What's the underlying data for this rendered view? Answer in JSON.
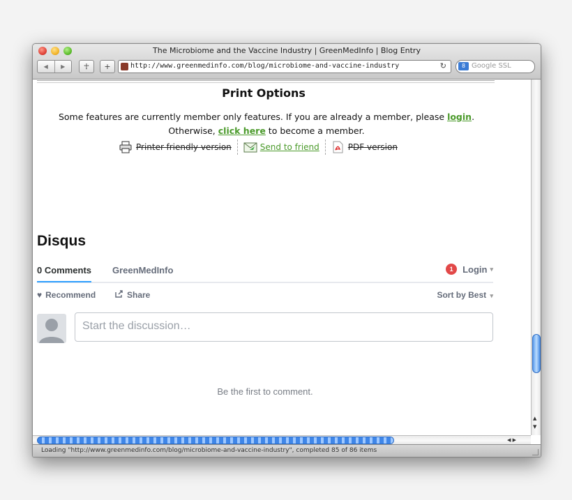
{
  "window": {
    "title": "The Microbiome and the Vaccine Industry | GreenMedInfo | Blog Entry"
  },
  "toolbar": {
    "back_glyph": "◀",
    "forward_glyph": "▶",
    "ankh_glyph": "☥",
    "add_glyph": "+",
    "url": "http://www.greenmedinfo.com/blog/microbiome-and-vaccine-industry",
    "reload_glyph": "↻",
    "search_badge": "8",
    "search_placeholder": "Google SSL"
  },
  "print_options": {
    "title": "Print Options",
    "line1_prefix": "Some features are currently member only features. If you are already a member, please ",
    "login_link": "login",
    "line1_suffix": ".",
    "line2_prefix": "Otherwise, ",
    "click_here_link": "click here",
    "line2_suffix": " to become a member.",
    "printer_friendly": "Printer-friendly version",
    "send_to_friend": "Send to friend",
    "pdf_version": "PDF version"
  },
  "disqus": {
    "title": "Disqus",
    "tab_comments": "0 Comments",
    "tab_site": "GreenMedInfo",
    "notification_count": "1",
    "login_label": "Login",
    "recommend_label": "Recommend",
    "share_label": "Share",
    "sort_label": "Sort by Best",
    "composer_placeholder": "Start the discussion…",
    "first_comment": "Be the first to comment."
  },
  "status_bar": {
    "text": "Loading \"http://www.greenmedinfo.com/blog/microbiome-and-vaccine-industry\", completed 85 of 86 items"
  },
  "colors": {
    "link_green": "#4a9a2a",
    "disqus_blue": "#2e9fff",
    "badge_red": "#e24848",
    "scroll_blue": "#3f86e8"
  }
}
